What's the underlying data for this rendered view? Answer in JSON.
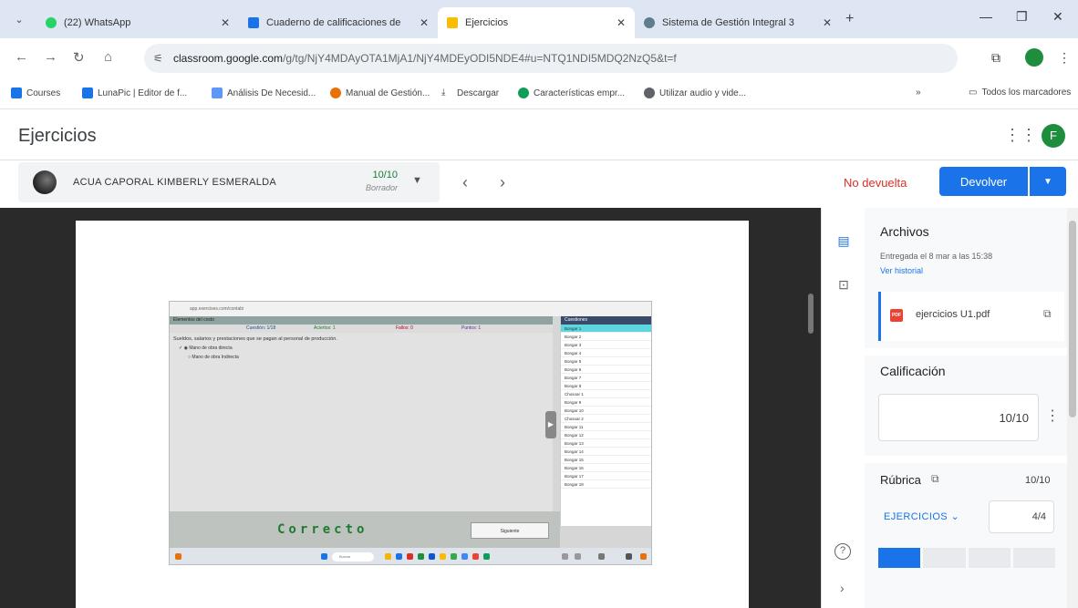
{
  "browser": {
    "tabs": [
      {
        "title": "(22) WhatsApp",
        "color": "#25d366",
        "active": false
      },
      {
        "title": "Cuaderno de calificaciones de",
        "color": "#1a73e8",
        "active": false
      },
      {
        "title": "Ejercicios",
        "color": "#fbbc04",
        "active": true
      },
      {
        "title": "Sistema de Gestión Integral 3",
        "color": "#607d8b",
        "active": false
      }
    ],
    "url_host": "classroom.google.com",
    "url_path": "/g/tg/NjY4MDAyOTA1MjA1/NjY4MDEyODI5NDE4#u=NTQ1NDI5MDQ2NzQ5&t=f",
    "bookmarks": [
      {
        "label": "Courses",
        "color": "#1a73e8"
      },
      {
        "label": "LunaPic | Editor de f...",
        "color": "#1a73e8"
      },
      {
        "label": "Análisis De Necesid...",
        "color": "#5e97f6"
      },
      {
        "label": "Manual de Gestión...",
        "color": "#e8710a"
      },
      {
        "label": "Descargar",
        "color": "#444444"
      },
      {
        "label": "Características empr...",
        "color": "#0f9d58"
      },
      {
        "label": "Utilizar audio y vide...",
        "color": "#5f6368"
      }
    ],
    "all_bookmarks": "Todos los marcadores"
  },
  "app": {
    "title": "Ejercicios",
    "avatar_letter": "F"
  },
  "student": {
    "name": "ACUA CAPORAL KIMBERLY ESMERALDA",
    "grade": "10/10",
    "status": "Borrador"
  },
  "actions": {
    "not_returned": "No devuelta",
    "return_label": "Devolver"
  },
  "embedded": {
    "url": "app.exercises.com/contabi",
    "header": "Elementos del costo",
    "stats": [
      "Cuestión: 1/18",
      "Aciertos: 1",
      "Fallos: 0",
      "Puntos: 1"
    ],
    "question": "Sueldos, salarios y prestaciones que se pagan al personal de producción.",
    "options": [
      "Mano de obra directa",
      "Mano de obra Indirecta"
    ],
    "side_header": "Cuestiones",
    "side_items": [
      "Bongar 1",
      "Bongar 2",
      "Bongar 3",
      "Bongar 4",
      "Bongar 5",
      "Bongar 6",
      "Bongar 7",
      "Bongar 8",
      "Chosoar 1",
      "Bongar 9",
      "Bongar 10",
      "Chosoar 2",
      "Bongar 11",
      "Bongar 12",
      "Bongar 13",
      "Bongar 14",
      "Bongar 15",
      "Bongar 16",
      "Bongar 17",
      "Bongar 18"
    ],
    "result": "Correcto",
    "next": "Siguiente",
    "search": "Buscar"
  },
  "panel": {
    "files_title": "Archivos",
    "submitted": "Entregada el 8 mar a las 15:38",
    "history": "Ver historial",
    "file_name": "ejercicios U1.pdf",
    "pdf_badge": "PDF",
    "grade_title": "Calificación",
    "grade_value": "10/10",
    "rubric_title": "Rúbrica",
    "rubric_total": "10/10",
    "criterion": "EJERCICIOS",
    "criterion_score": "4/4",
    "levels_selected": 1,
    "levels_total": 4
  },
  "icons": {
    "back": "arrow-left-icon",
    "forward": "arrow-right-icon",
    "reload": "reload-icon",
    "home": "home-icon"
  }
}
